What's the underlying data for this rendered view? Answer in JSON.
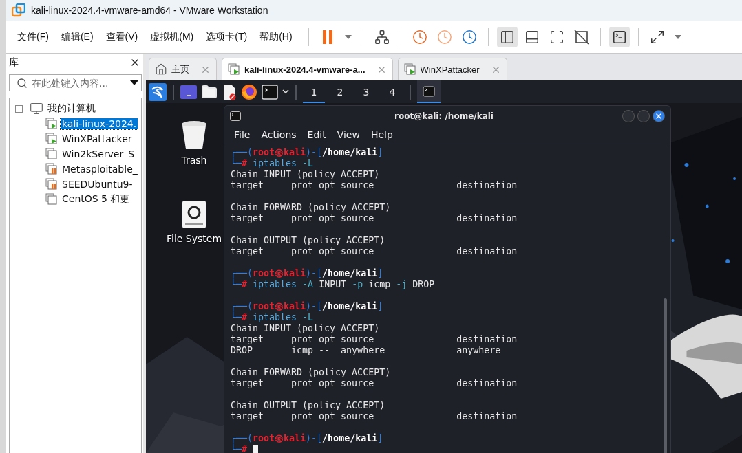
{
  "window": {
    "title": "kali-linux-2024.4-vmware-amd64 - VMware Workstation"
  },
  "menu": [
    "文件(F)",
    "编辑(E)",
    "查看(V)",
    "虚拟机(M)",
    "选项卡(T)",
    "帮助(H)"
  ],
  "toolbar": [
    [
      {
        "kind": "pause",
        "selected": false
      },
      {
        "kind": "caret",
        "selected": false
      }
    ],
    [
      {
        "kind": "send-keys",
        "selected": false
      }
    ],
    [
      {
        "kind": "snapshot-take",
        "selected": false
      },
      {
        "kind": "snapshot-revert",
        "selected": false
      },
      {
        "kind": "snapshot-manage",
        "selected": false
      }
    ],
    [
      {
        "kind": "library",
        "selected": true
      },
      {
        "kind": "thumbnails",
        "selected": false
      },
      {
        "kind": "fullscreen",
        "selected": false
      },
      {
        "kind": "unity",
        "selected": false
      }
    ],
    [
      {
        "kind": "console",
        "selected": true
      }
    ],
    [
      {
        "kind": "stretch",
        "selected": false
      },
      {
        "kind": "caret",
        "selected": false
      }
    ]
  ],
  "library": {
    "title": "库",
    "search": {
      "placeholder": "在此处键入内容..."
    },
    "tree": [
      {
        "label": "我的计算机",
        "expanded": true,
        "selected": false,
        "children": [
          {
            "label": "kali-linux-2024.",
            "powered_on": true,
            "suspended": false,
            "selected": true
          },
          {
            "label": "WinXPattacker",
            "powered_on": true,
            "suspended": false,
            "selected": false
          },
          {
            "label": "Win2kServer_S",
            "powered_on": false,
            "suspended": false,
            "selected": false
          },
          {
            "label": "Metasploitable_",
            "powered_on": false,
            "suspended": true,
            "selected": false
          },
          {
            "label": "SEEDUbuntu9-",
            "powered_on": false,
            "suspended": true,
            "selected": false
          },
          {
            "label": "CentOS 5 和更",
            "powered_on": false,
            "suspended": false,
            "selected": false
          }
        ]
      }
    ]
  },
  "tabs": [
    {
      "label": "主页",
      "kind": "home",
      "selected": false
    },
    {
      "label": "kali-linux-2024.4-vmware-a...",
      "kind": "vm",
      "selected": true
    },
    {
      "label": "WinXPattacker",
      "kind": "vm",
      "selected": false
    }
  ],
  "guest": {
    "panel": {
      "launchers": [
        {
          "kind": "logo"
        },
        {
          "kind": "separator"
        },
        {
          "kind": "workspace-switcher"
        },
        {
          "kind": "files"
        },
        {
          "kind": "editor"
        },
        {
          "kind": "browser"
        },
        {
          "kind": "terminal"
        },
        {
          "kind": "caret"
        },
        {
          "kind": "separator"
        }
      ],
      "workspaces": [
        {
          "label": "1",
          "selected": true
        },
        {
          "label": "2",
          "selected": false
        },
        {
          "label": "3",
          "selected": false
        },
        {
          "label": "4",
          "selected": false
        }
      ],
      "windows": [
        {
          "kind": "terminal",
          "selected": true
        }
      ]
    },
    "desktop_icons": [
      {
        "label": "Trash",
        "kind": "trash"
      },
      {
        "label": "File System",
        "kind": "drive"
      }
    ],
    "terminal": {
      "title": "root@kali: /home/kali",
      "menu": [
        "File",
        "Actions",
        "Edit",
        "View",
        "Help"
      ],
      "lines": [
        {
          "kind": "text",
          "segments": [
            {
              "text": "┌──(",
              "kind": "frame"
            },
            {
              "text": "root㉿kali",
              "kind": "user"
            },
            {
              "text": ")-[",
              "kind": "frame"
            },
            {
              "text": "/home/kali",
              "kind": "path"
            },
            {
              "text": "]",
              "kind": "frame"
            }
          ]
        },
        {
          "kind": "text",
          "segments": [
            {
              "text": "└─",
              "kind": "frame"
            },
            {
              "text": "#",
              "kind": "hash"
            },
            {
              "text": " iptables",
              "kind": "cmd"
            },
            {
              "text": " -L",
              "kind": "flag"
            }
          ]
        },
        {
          "kind": "text",
          "segments": [
            {
              "text": "Chain INPUT (policy ACCEPT)",
              "kind": "out"
            }
          ]
        },
        {
          "kind": "text",
          "segments": [
            {
              "text": "target     prot opt source               destination",
              "kind": "out"
            }
          ]
        },
        {
          "kind": "blank"
        },
        {
          "kind": "text",
          "segments": [
            {
              "text": "Chain FORWARD (policy ACCEPT)",
              "kind": "out"
            }
          ]
        },
        {
          "kind": "text",
          "segments": [
            {
              "text": "target     prot opt source               destination",
              "kind": "out"
            }
          ]
        },
        {
          "kind": "blank"
        },
        {
          "kind": "text",
          "segments": [
            {
              "text": "Chain OUTPUT (policy ACCEPT)",
              "kind": "out"
            }
          ]
        },
        {
          "kind": "text",
          "segments": [
            {
              "text": "target     prot opt source               destination",
              "kind": "out"
            }
          ]
        },
        {
          "kind": "blank"
        },
        {
          "kind": "text",
          "segments": [
            {
              "text": "┌──(",
              "kind": "frame"
            },
            {
              "text": "root㉿kali",
              "kind": "user"
            },
            {
              "text": ")-[",
              "kind": "frame"
            },
            {
              "text": "/home/kali",
              "kind": "path"
            },
            {
              "text": "]",
              "kind": "frame"
            }
          ]
        },
        {
          "kind": "text",
          "segments": [
            {
              "text": "└─",
              "kind": "frame"
            },
            {
              "text": "#",
              "kind": "hash"
            },
            {
              "text": " iptables",
              "kind": "cmd"
            },
            {
              "text": " -A",
              "kind": "flag"
            },
            {
              "text": " INPUT",
              "kind": "out"
            },
            {
              "text": " -p",
              "kind": "flag"
            },
            {
              "text": " icmp",
              "kind": "out"
            },
            {
              "text": " -j",
              "kind": "flag"
            },
            {
              "text": " DROP",
              "kind": "out"
            }
          ]
        },
        {
          "kind": "blank"
        },
        {
          "kind": "text",
          "segments": [
            {
              "text": "┌──(",
              "kind": "frame"
            },
            {
              "text": "root㉿kali",
              "kind": "user"
            },
            {
              "text": ")-[",
              "kind": "frame"
            },
            {
              "text": "/home/kali",
              "kind": "path"
            },
            {
              "text": "]",
              "kind": "frame"
            }
          ]
        },
        {
          "kind": "text",
          "segments": [
            {
              "text": "└─",
              "kind": "frame"
            },
            {
              "text": "#",
              "kind": "hash"
            },
            {
              "text": " iptables",
              "kind": "cmd"
            },
            {
              "text": " -L",
              "kind": "flag"
            }
          ]
        },
        {
          "kind": "text",
          "segments": [
            {
              "text": "Chain INPUT (policy ACCEPT)",
              "kind": "out"
            }
          ]
        },
        {
          "kind": "text",
          "segments": [
            {
              "text": "target     prot opt source               destination",
              "kind": "out"
            }
          ]
        },
        {
          "kind": "text",
          "segments": [
            {
              "text": "DROP       icmp --  anywhere             anywhere",
              "kind": "out"
            }
          ]
        },
        {
          "kind": "blank"
        },
        {
          "kind": "text",
          "segments": [
            {
              "text": "Chain FORWARD (policy ACCEPT)",
              "kind": "out"
            }
          ]
        },
        {
          "kind": "text",
          "segments": [
            {
              "text": "target     prot opt source               destination",
              "kind": "out"
            }
          ]
        },
        {
          "kind": "blank"
        },
        {
          "kind": "text",
          "segments": [
            {
              "text": "Chain OUTPUT (policy ACCEPT)",
              "kind": "out"
            }
          ]
        },
        {
          "kind": "text",
          "segments": [
            {
              "text": "target     prot opt source               destination",
              "kind": "out"
            }
          ]
        },
        {
          "kind": "blank"
        },
        {
          "kind": "text",
          "segments": [
            {
              "text": "┌──(",
              "kind": "frame"
            },
            {
              "text": "root㉿kali",
              "kind": "user"
            },
            {
              "text": ")-[",
              "kind": "frame"
            },
            {
              "text": "/home/kali",
              "kind": "path"
            },
            {
              "text": "]",
              "kind": "frame"
            }
          ]
        },
        {
          "kind": "text",
          "cursor": true,
          "segments": [
            {
              "text": "└─",
              "kind": "frame"
            },
            {
              "text": "#",
              "kind": "hash"
            }
          ]
        }
      ]
    }
  }
}
